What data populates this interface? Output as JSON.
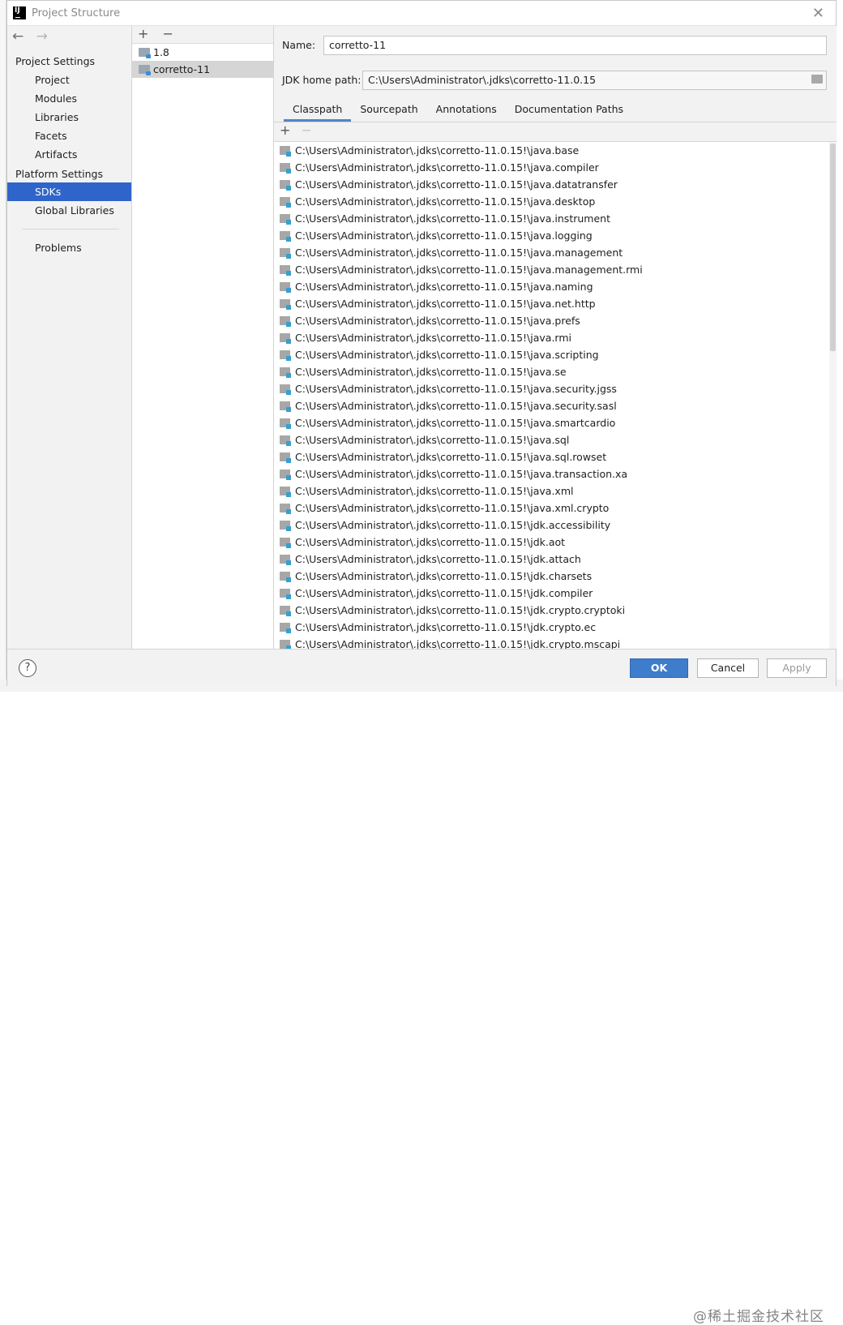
{
  "window": {
    "title": "Project Structure",
    "close_label": "✕"
  },
  "nav": {
    "back": "←",
    "forward": "→",
    "project_settings_header": "Project Settings",
    "project_settings_items": [
      "Project",
      "Modules",
      "Libraries",
      "Facets",
      "Artifacts"
    ],
    "platform_settings_header": "Platform Settings",
    "platform_settings_items": [
      "SDKs",
      "Global Libraries"
    ],
    "problems": "Problems"
  },
  "sdk_list": {
    "add": "+",
    "remove": "−",
    "items": [
      "1.8",
      "corretto-11"
    ]
  },
  "details": {
    "name_label": "Name:",
    "name_value": "corretto-11",
    "jdk_home_label": "JDK home path:",
    "jdk_home_value": "C:\\Users\\Administrator\\.jdks\\corretto-11.0.15",
    "tabs": [
      "Classpath",
      "Sourcepath",
      "Annotations",
      "Documentation Paths"
    ],
    "active_tab": "Classpath",
    "classpath_add": "+",
    "classpath_remove": "−",
    "classpath": [
      "C:\\Users\\Administrator\\.jdks\\corretto-11.0.15!\\java.base",
      "C:\\Users\\Administrator\\.jdks\\corretto-11.0.15!\\java.compiler",
      "C:\\Users\\Administrator\\.jdks\\corretto-11.0.15!\\java.datatransfer",
      "C:\\Users\\Administrator\\.jdks\\corretto-11.0.15!\\java.desktop",
      "C:\\Users\\Administrator\\.jdks\\corretto-11.0.15!\\java.instrument",
      "C:\\Users\\Administrator\\.jdks\\corretto-11.0.15!\\java.logging",
      "C:\\Users\\Administrator\\.jdks\\corretto-11.0.15!\\java.management",
      "C:\\Users\\Administrator\\.jdks\\corretto-11.0.15!\\java.management.rmi",
      "C:\\Users\\Administrator\\.jdks\\corretto-11.0.15!\\java.naming",
      "C:\\Users\\Administrator\\.jdks\\corretto-11.0.15!\\java.net.http",
      "C:\\Users\\Administrator\\.jdks\\corretto-11.0.15!\\java.prefs",
      "C:\\Users\\Administrator\\.jdks\\corretto-11.0.15!\\java.rmi",
      "C:\\Users\\Administrator\\.jdks\\corretto-11.0.15!\\java.scripting",
      "C:\\Users\\Administrator\\.jdks\\corretto-11.0.15!\\java.se",
      "C:\\Users\\Administrator\\.jdks\\corretto-11.0.15!\\java.security.jgss",
      "C:\\Users\\Administrator\\.jdks\\corretto-11.0.15!\\java.security.sasl",
      "C:\\Users\\Administrator\\.jdks\\corretto-11.0.15!\\java.smartcardio",
      "C:\\Users\\Administrator\\.jdks\\corretto-11.0.15!\\java.sql",
      "C:\\Users\\Administrator\\.jdks\\corretto-11.0.15!\\java.sql.rowset",
      "C:\\Users\\Administrator\\.jdks\\corretto-11.0.15!\\java.transaction.xa",
      "C:\\Users\\Administrator\\.jdks\\corretto-11.0.15!\\java.xml",
      "C:\\Users\\Administrator\\.jdks\\corretto-11.0.15!\\java.xml.crypto",
      "C:\\Users\\Administrator\\.jdks\\corretto-11.0.15!\\jdk.accessibility",
      "C:\\Users\\Administrator\\.jdks\\corretto-11.0.15!\\jdk.aot",
      "C:\\Users\\Administrator\\.jdks\\corretto-11.0.15!\\jdk.attach",
      "C:\\Users\\Administrator\\.jdks\\corretto-11.0.15!\\jdk.charsets",
      "C:\\Users\\Administrator\\.jdks\\corretto-11.0.15!\\jdk.compiler",
      "C:\\Users\\Administrator\\.jdks\\corretto-11.0.15!\\jdk.crypto.cryptoki",
      "C:\\Users\\Administrator\\.jdks\\corretto-11.0.15!\\jdk.crypto.ec",
      "C:\\Users\\Administrator\\.jdks\\corretto-11.0.15!\\jdk.crypto.mscapi"
    ]
  },
  "buttons": {
    "help": "?",
    "ok": "OK",
    "cancel": "Cancel",
    "apply": "Apply"
  },
  "watermark": "@稀土掘金技术社区",
  "colors": {
    "selection": "#2f65ca",
    "ok_button": "#3e7ccc",
    "tab_underline": "#4a88c7"
  }
}
